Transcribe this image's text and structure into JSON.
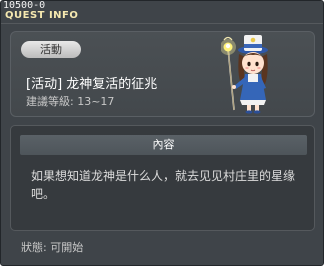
{
  "window": {
    "quest_id": "10500-0",
    "title": "QUEST INFO"
  },
  "quest": {
    "category": "活動",
    "name": "[活动] 龙神复活的征兆",
    "required_level": "建議等級: 13~17"
  },
  "content": {
    "header": "內容",
    "body": "如果想知道龙神是什么人，就去见见村庄里的星缘吧。"
  },
  "status": "狀態: 可開始",
  "npc": {
    "icon": "npc-character-with-lantern-staff"
  }
}
